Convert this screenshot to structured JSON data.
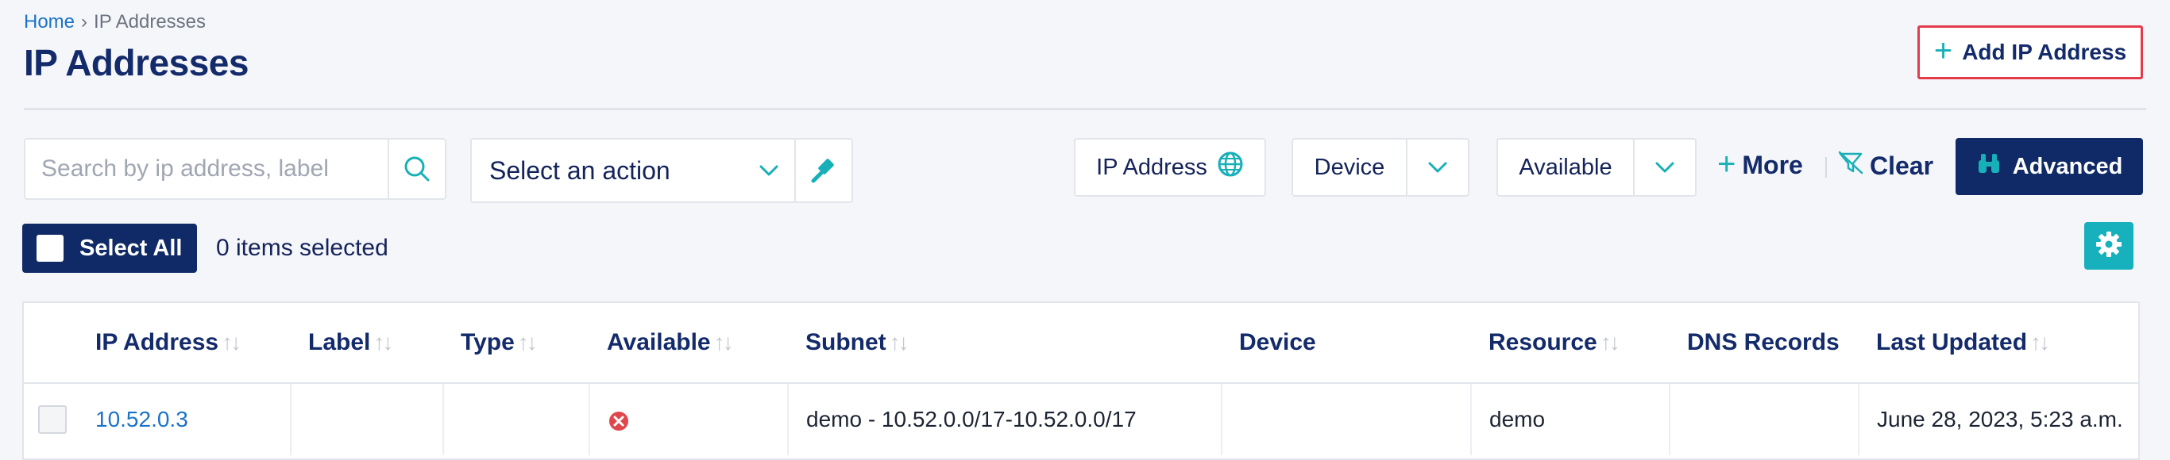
{
  "breadcrumb": {
    "home": "Home",
    "separator": "›",
    "current": "IP Addresses"
  },
  "page": {
    "title": "IP Addresses"
  },
  "header": {
    "add_button": "Add IP Address"
  },
  "toolbar": {
    "search_placeholder": "Search by ip address, label",
    "action_select": "Select an action",
    "filters": {
      "ip_address": "IP Address",
      "device": "Device",
      "available": "Available"
    },
    "more": "More",
    "clear": "Clear",
    "advanced": "Advanced"
  },
  "selection": {
    "select_all": "Select All",
    "count_text": "0 items selected"
  },
  "table": {
    "columns": [
      "IP Address",
      "Label",
      "Type",
      "Available",
      "Subnet",
      "Device",
      "Resource",
      "DNS Records",
      "Last Updated"
    ],
    "sort_glyph": "↑↓",
    "rows": [
      {
        "ip": "10.52.0.3",
        "label": "",
        "type": "",
        "available": "no",
        "subnet": "demo - 10.52.0.0/17-10.52.0.0/17",
        "device": "",
        "resource": "demo",
        "dns_records": "",
        "last_updated": "June 28, 2023, 5:23 a.m."
      }
    ]
  },
  "colors": {
    "navy": "#0f2a66",
    "teal": "#18b0b8",
    "link": "#1a73c9",
    "highlight_border": "#e43b4a",
    "unavailable": "#e0474c"
  },
  "icons": [
    "search-icon",
    "chevron-down-icon",
    "gavel-icon",
    "globe-icon",
    "plus-icon",
    "clear-filter-icon",
    "binoculars-icon",
    "gear-icon",
    "unavailable-icon",
    "sort-icon"
  ]
}
